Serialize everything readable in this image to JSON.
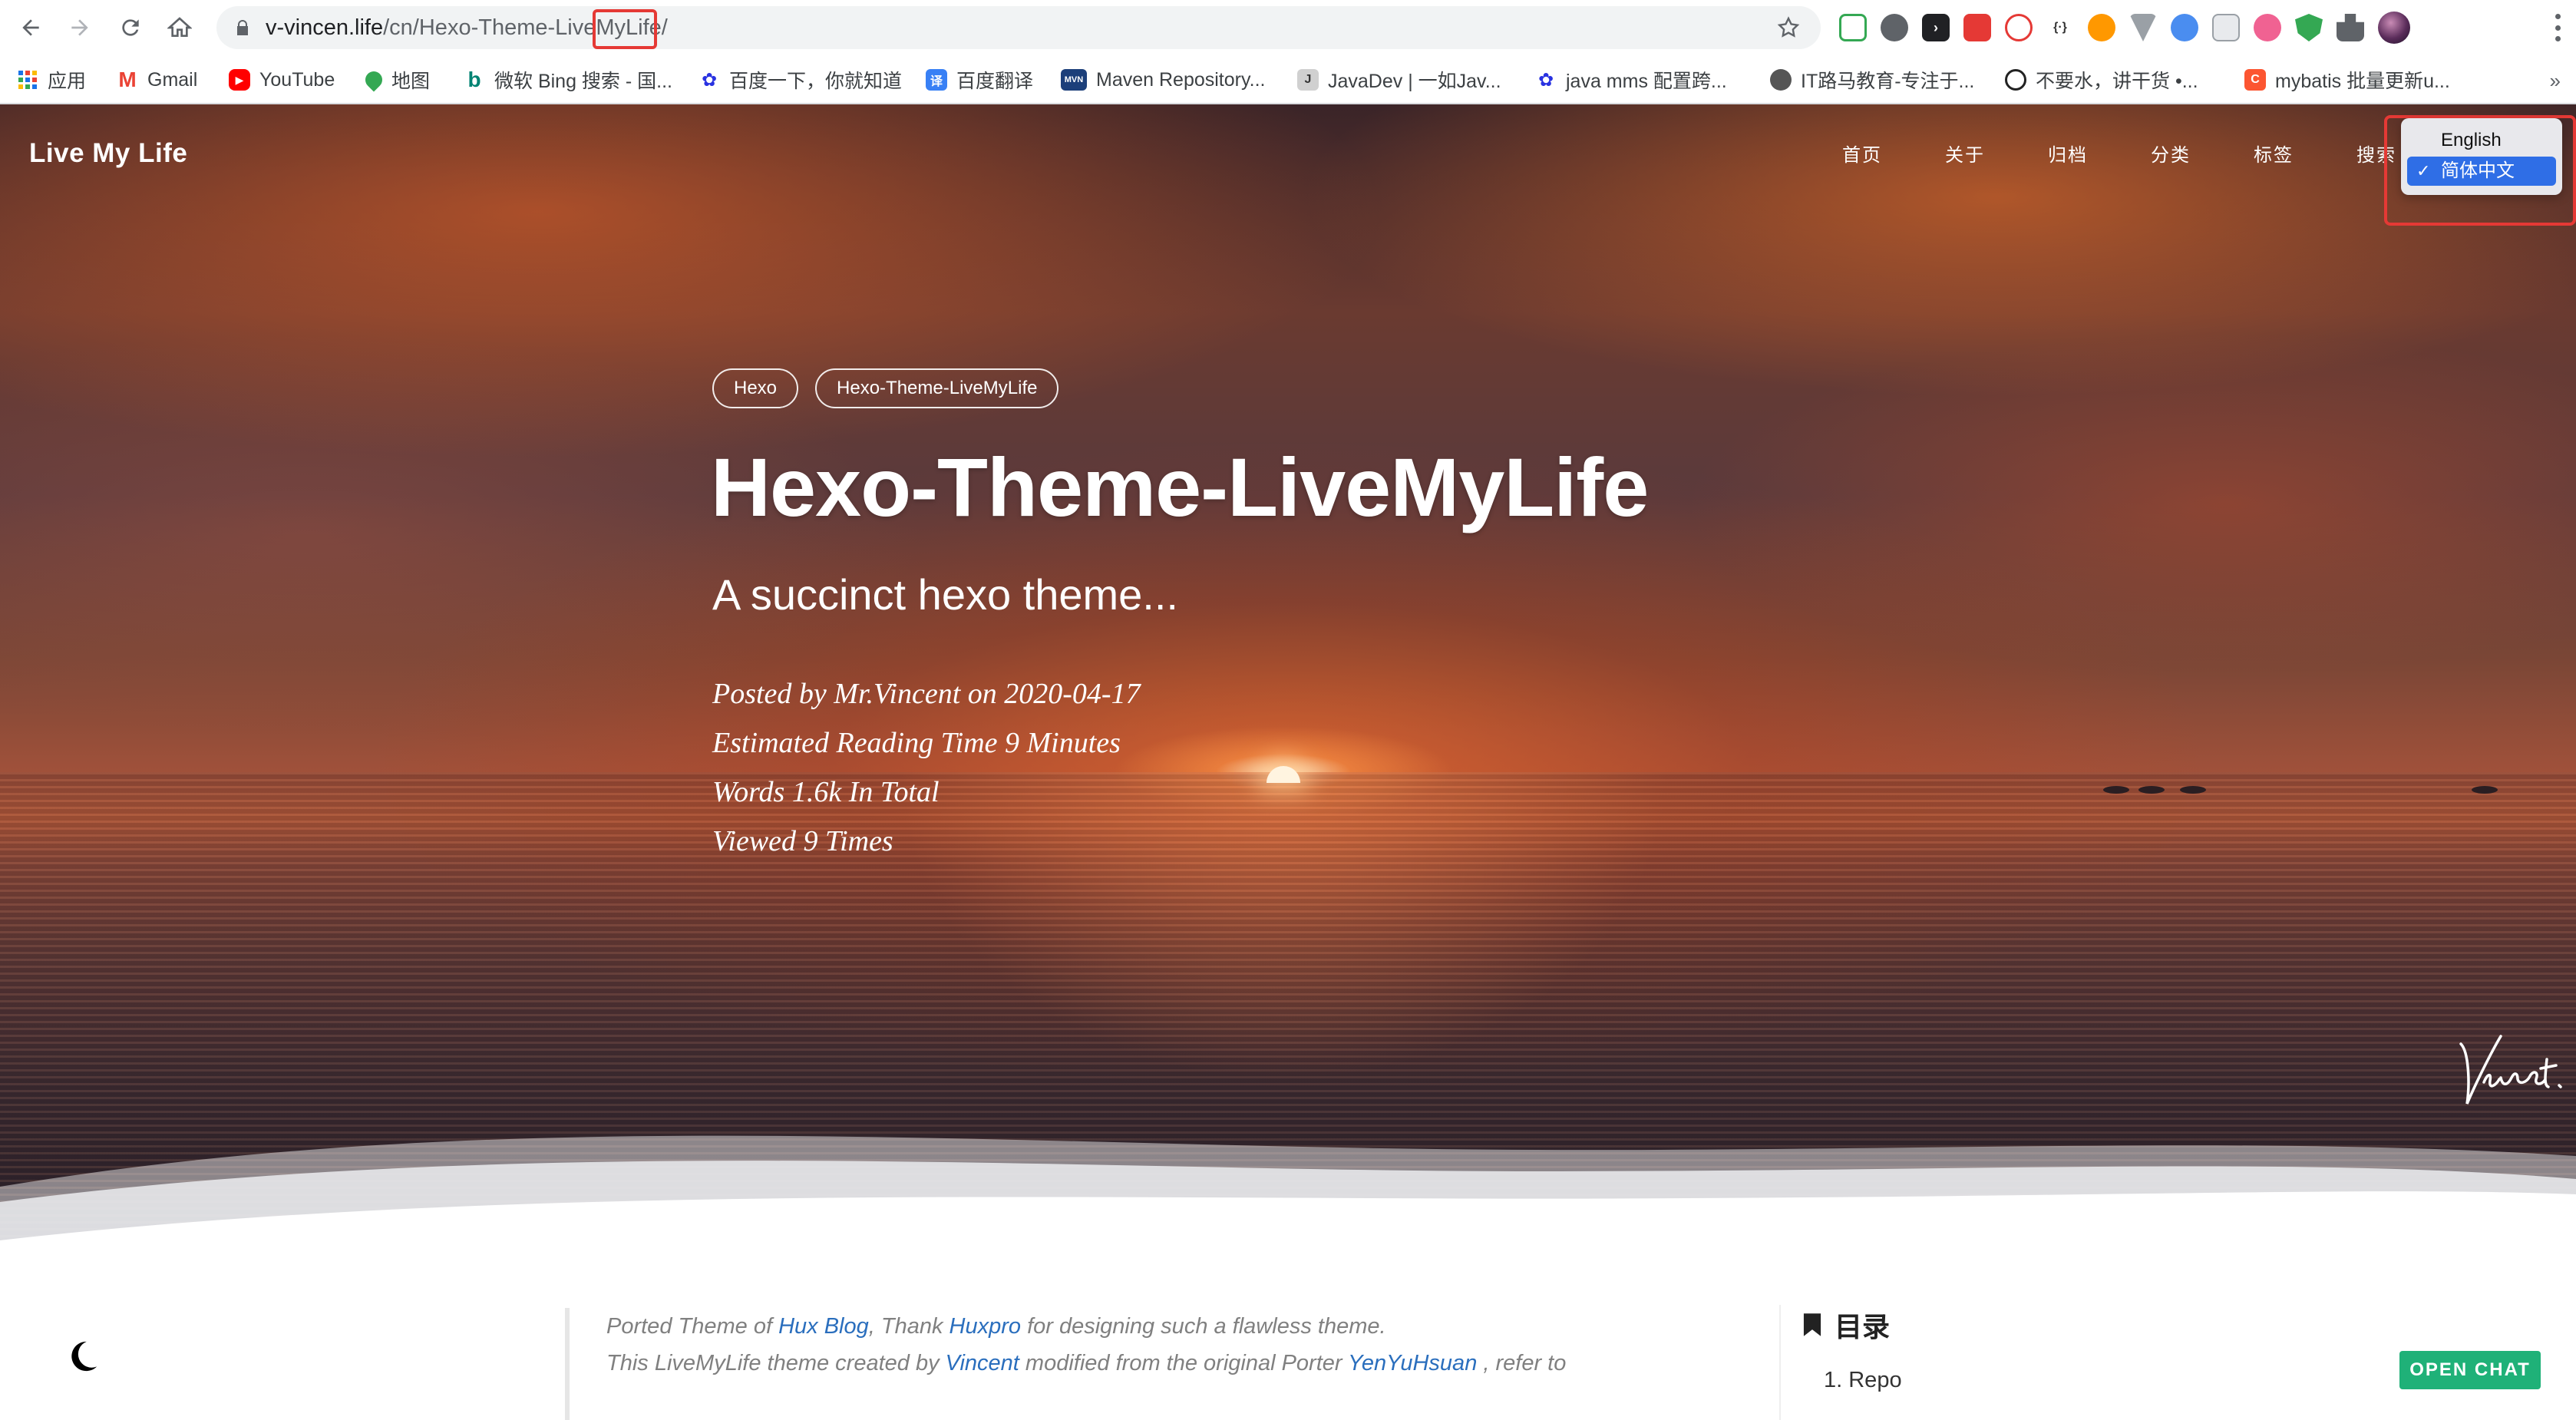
{
  "browser": {
    "url_host": "v-vincen.life",
    "url_path": "/cn/Hexo-Theme-LiveMyLife/",
    "bookmarks": [
      {
        "label": "应用",
        "icon": "apps-grid-icon",
        "color": "#1a73e8"
      },
      {
        "label": "Gmail",
        "icon": "gmail-icon",
        "color": "#ea4335"
      },
      {
        "label": "YouTube",
        "icon": "youtube-icon",
        "color": "#ff0000"
      },
      {
        "label": "地图",
        "icon": "maps-pin-icon",
        "color": "#34a853"
      },
      {
        "label": "微软 Bing 搜索 - 国...",
        "icon": "bing-icon",
        "color": "#008373"
      },
      {
        "label": "百度一下，你就知道",
        "icon": "baidu-paw-icon",
        "color": "#2932e1"
      },
      {
        "label": "百度翻译",
        "icon": "baidu-translate-icon",
        "color": "#3880f5"
      },
      {
        "label": "Maven Repository...",
        "icon": "mvn-icon",
        "color": "#1c3f7a"
      },
      {
        "label": "JavaDev | 一如Jav...",
        "icon": "javadev-icon",
        "color": "#444444"
      },
      {
        "label": "java mms 配置跨...",
        "icon": "baidu-paw-icon",
        "color": "#2932e1"
      },
      {
        "label": "IT路马教育-专注于...",
        "icon": "globe-icon",
        "color": "#555555"
      },
      {
        "label": "不要水，讲干货 •...",
        "icon": "person-icon",
        "color": "#222222"
      },
      {
        "label": "mybatis 批量更新u...",
        "icon": "csdn-c-icon",
        "color": "#fc5531"
      }
    ],
    "overflow_label": "»"
  },
  "site": {
    "brand": "Live My Life",
    "nav": [
      "首页",
      "关于",
      "归档",
      "分类",
      "标签",
      "搜索"
    ],
    "languages": [
      {
        "label": "English",
        "selected": false
      },
      {
        "label": "简体中文",
        "selected": true
      }
    ],
    "selected_mark": "✓"
  },
  "post": {
    "tags": [
      "Hexo",
      "Hexo-Theme-LiveMyLife"
    ],
    "title": "Hexo-Theme-LiveMyLife",
    "subtitle": "A succinct hexo theme...",
    "meta": [
      "Posted by Mr.Vincent on 2020-04-17",
      "Estimated Reading Time 9 Minutes",
      "Words 1.6k In Total",
      "Viewed 9 Times"
    ]
  },
  "article": {
    "line1": {
      "pre": "Ported Theme of ",
      "link1": "Hux Blog",
      "mid": ", Thank ",
      "link2": "Huxpro",
      "post": " for designing such a flawless theme."
    },
    "line2": {
      "pre": "This LiveMyLife theme created by ",
      "link1": "Vincent",
      "mid": " modified from the original Porter ",
      "link2": "YenYuHsuan",
      "post": " , refer to"
    }
  },
  "toc": {
    "title": "目录",
    "items": [
      "1. Repo"
    ]
  },
  "chat": {
    "label": "OPEN CHAT"
  }
}
